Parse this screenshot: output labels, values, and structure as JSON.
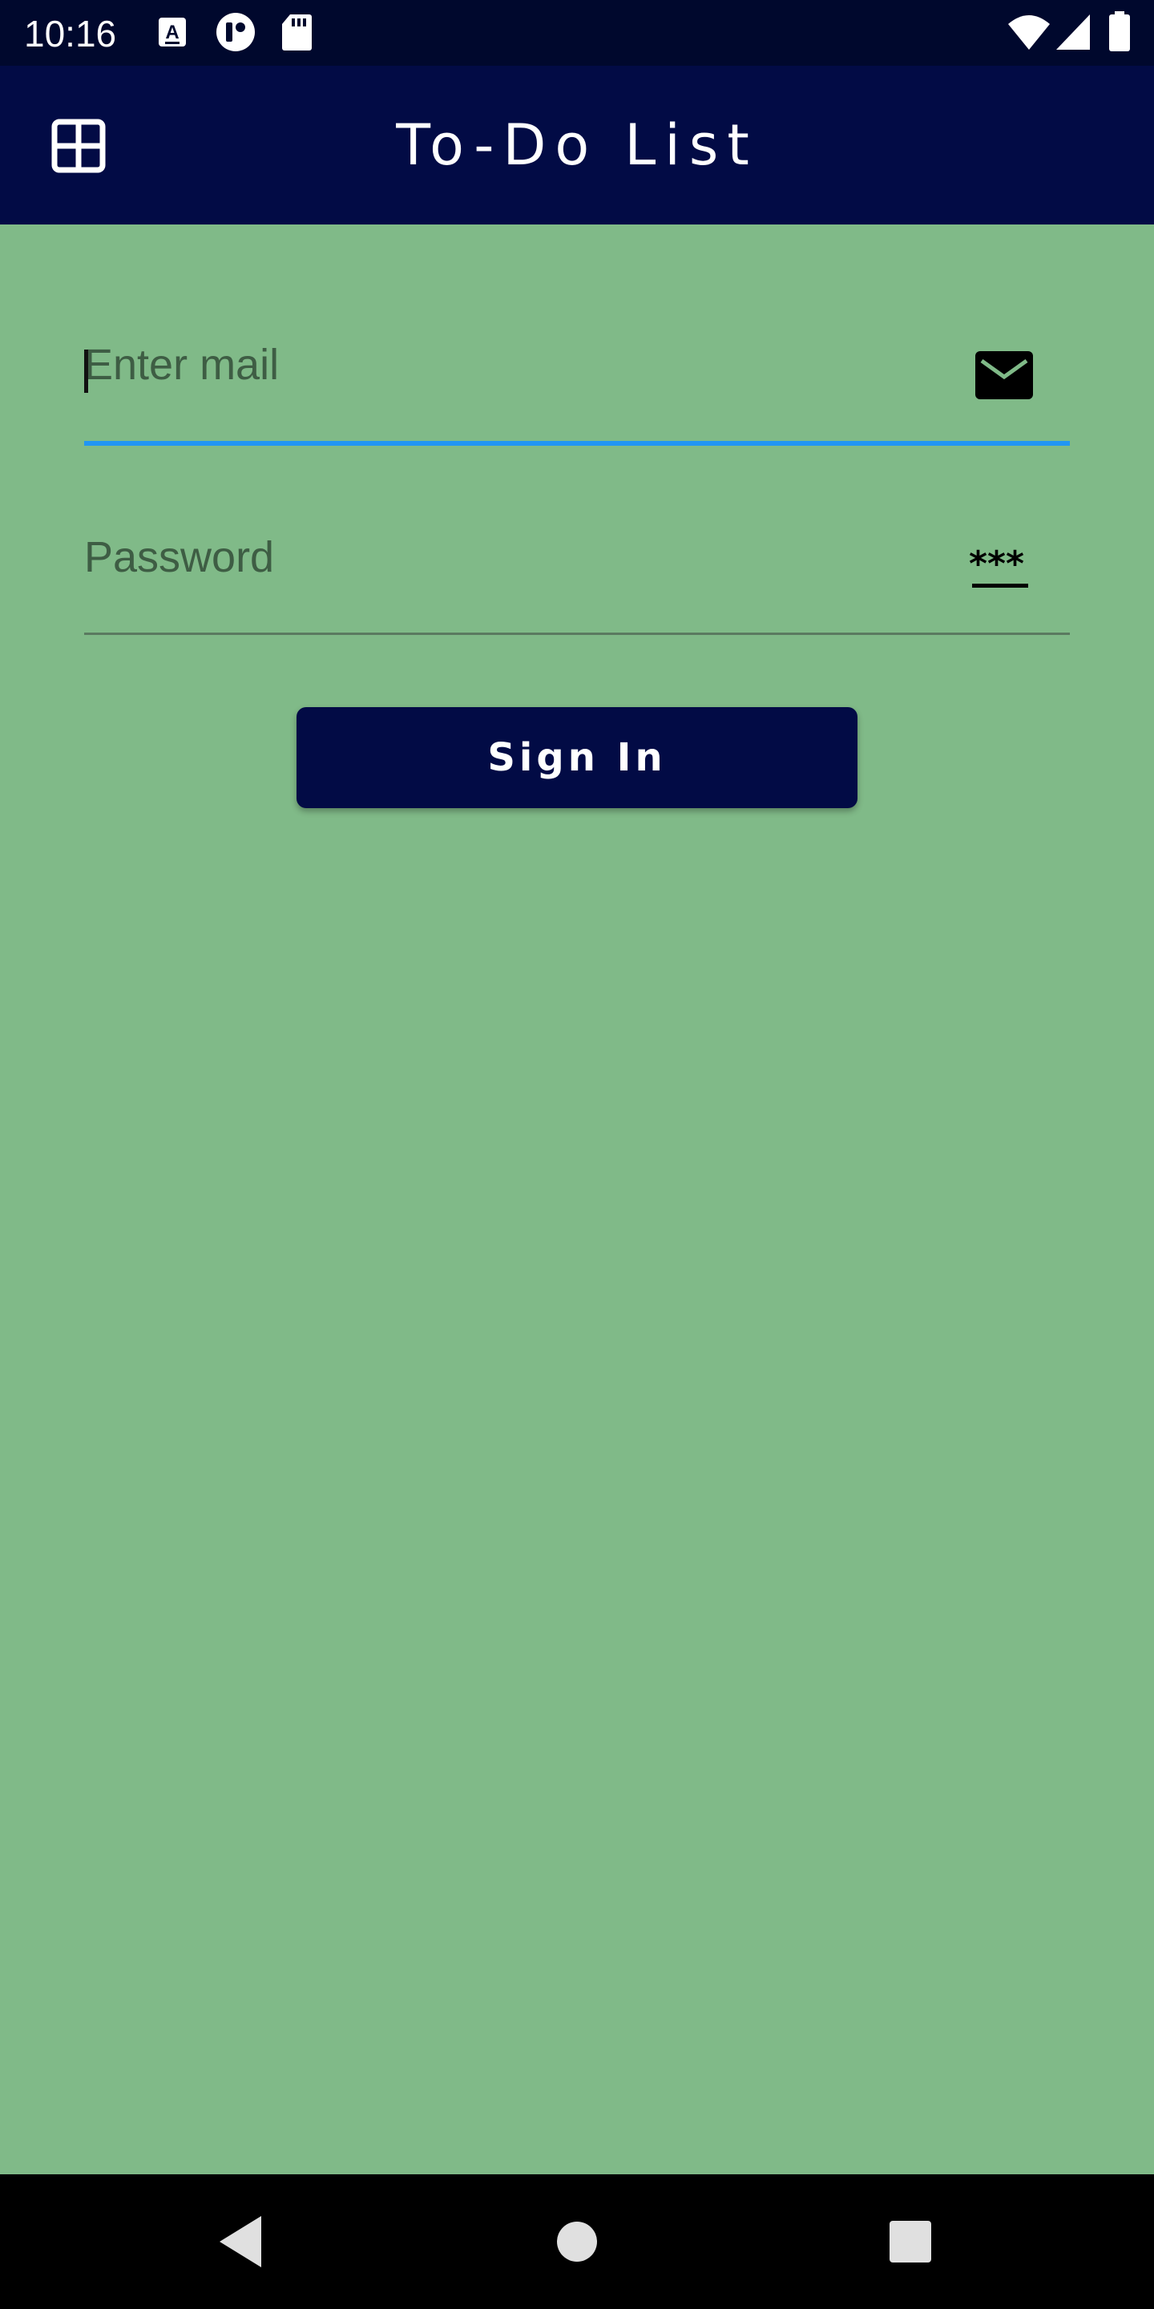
{
  "status_bar": {
    "time": "10:16",
    "left_icons": [
      "accessibility-a-icon",
      "vpn-key-icon",
      "sd-card-icon"
    ],
    "right_icons": [
      "wifi-icon",
      "cell-signal-icon",
      "battery-icon"
    ]
  },
  "app_bar": {
    "title": "To-Do List",
    "menu_icon": "grid-icon",
    "background": "#020b45"
  },
  "form": {
    "email": {
      "placeholder": "Enter mail",
      "value": "",
      "icon": "mail-icon",
      "focused": true,
      "underline_color": "#2196f3"
    },
    "password": {
      "placeholder": "Password",
      "value": "",
      "icon": "password-icon"
    },
    "sign_in_label": "Sign In"
  },
  "nav_bar": {
    "buttons": [
      "back-icon",
      "home-icon",
      "recents-icon"
    ]
  },
  "colors": {
    "page_background": "#80ba88",
    "status_bar": "#00082d",
    "primary": "#020b45",
    "accent": "#2196f3"
  }
}
